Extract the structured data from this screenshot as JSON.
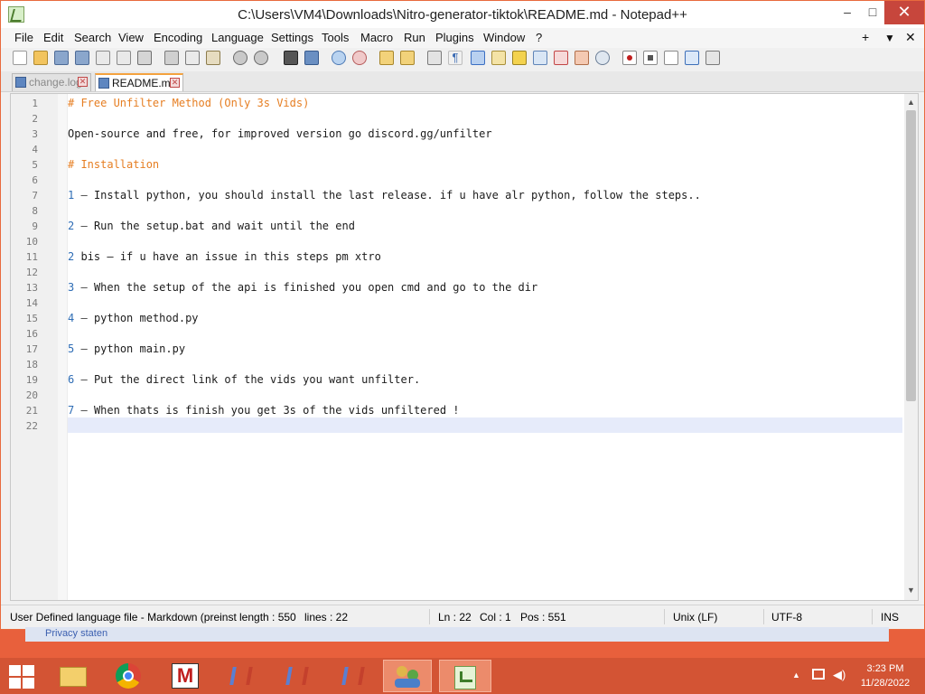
{
  "window": {
    "title": "C:\\Users\\VM4\\Downloads\\Nitro-generator-tiktok\\README.md - Notepad++",
    "minimize": "–",
    "maximize": "□",
    "close": "✕"
  },
  "menu": {
    "items": [
      "File",
      "Edit",
      "Search",
      "View",
      "Encoding",
      "Language",
      "Settings",
      "Tools",
      "Macro",
      "Run",
      "Plugins",
      "Window",
      "?"
    ],
    "right_plus": "+",
    "right_down": "▼",
    "right_close": "✕"
  },
  "tabs": [
    {
      "label": "change.log",
      "close": "✕"
    },
    {
      "label": "README.md",
      "close": "✕"
    }
  ],
  "editor": {
    "line_numbers": [
      "1",
      "2",
      "3",
      "4",
      "5",
      "6",
      "7",
      "8",
      "9",
      "10",
      "11",
      "12",
      "13",
      "14",
      "15",
      "16",
      "17",
      "18",
      "19",
      "20",
      "21",
      "22"
    ],
    "lines": {
      "l1": "# Free Unfilter Method (Only 3s Vids)",
      "l3": "Open-source and free, for improved version go discord.gg/unfilter",
      "l5": "# Installation",
      "l7": "Install python, you should install the last release. if u have alr python, follow the steps..",
      "l9": "Run the setup.bat and wait until the end",
      "l11_num": "2",
      "l11_text": "bis – if u have an issue in this steps pm xtro",
      "l13": "When the setup of the api is finished you open cmd and go to the dir",
      "l15": "python method.py",
      "l17": "python main.py",
      "l19": "Put the direct link of the vids you want unfilter.",
      "l21": "When thats is finish you get 3s of the vids unfiltered !"
    },
    "step_numbers": [
      "1",
      "2",
      "3",
      "4",
      "5",
      "6",
      "7"
    ],
    "dash": "–"
  },
  "status": {
    "language": "User Defined language file - Markdown (preinst",
    "length": "length : 550",
    "lines": "lines : 22",
    "ln": "Ln : 22",
    "col": "Col : 1",
    "pos": "Pos : 551",
    "eol": "Unix (LF)",
    "encoding": "UTF-8",
    "mode": "INS"
  },
  "background_window": {
    "text": "Privacy staten"
  },
  "taskbar": {
    "time": "3:23 PM",
    "date": "11/28/2022"
  }
}
